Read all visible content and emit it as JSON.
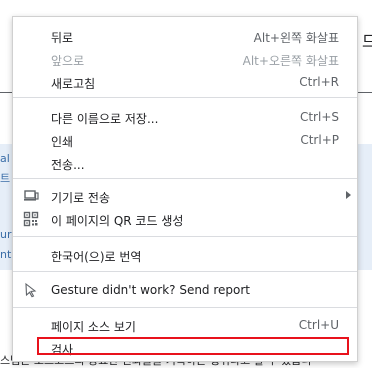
{
  "menu": {
    "items": [
      {
        "label": "뒤로",
        "shortcut": "Alt+왼쪽 화살표"
      },
      {
        "label": "앞으로",
        "shortcut": "Alt+오른쪽 화살표"
      },
      {
        "label": "새로고침",
        "shortcut": "Ctrl+R"
      },
      {
        "label": "다른 이름으로 저장...",
        "shortcut": "Ctrl+S"
      },
      {
        "label": "인쇄",
        "shortcut": "Ctrl+P"
      },
      {
        "label": "전송..."
      },
      {
        "label": "기기로 전송"
      },
      {
        "label": "이 페이지의 QR 코드 생성"
      },
      {
        "label": "한국어(으)로 번역"
      },
      {
        "label": "Gesture didn't work? Send report"
      },
      {
        "label": "페이지 소스 보기",
        "shortcut": "Ctrl+U"
      },
      {
        "label": "검사"
      }
    ]
  },
  "highlight_color": "#e8121c",
  "background": {
    "fragments": [
      "al",
      "트",
      "ur",
      "nt",
      "므"
    ],
    "bottom_text": "스템은 소스코드의 중요한 변화들을 기록하는 형위라고 할 수 있습니"
  }
}
